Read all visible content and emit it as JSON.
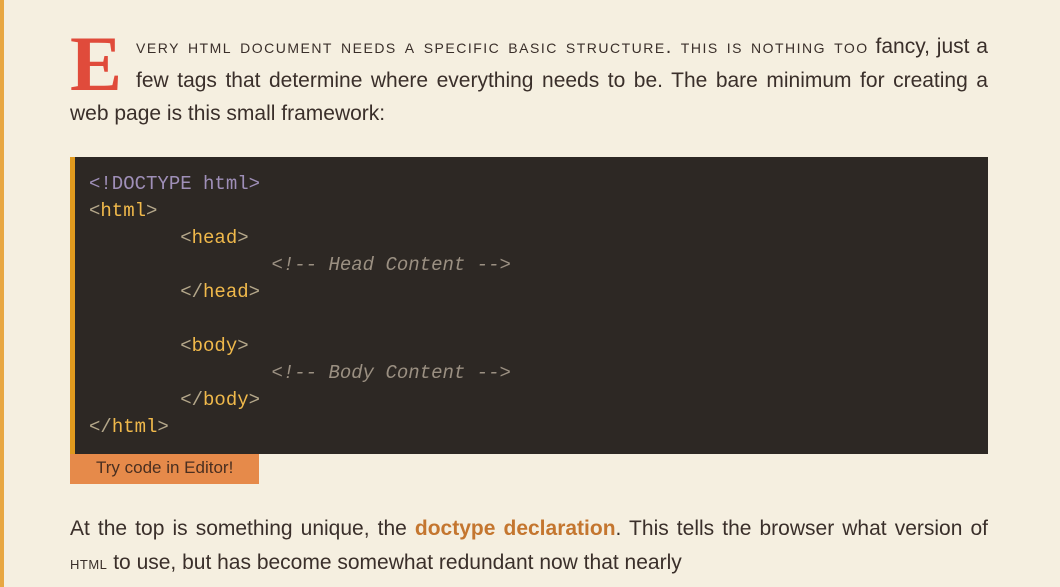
{
  "para1": {
    "dropcap": "E",
    "smallcaps_lead": "very html document needs a specific basic structure. this is nothing too",
    "rest": " fancy, just a few tags that determine where everything needs to be. The bare minimum for creating a web page is this small framework:"
  },
  "code": {
    "l1_doctype": "<!DOCTYPE html>",
    "tag_html_open": "html",
    "tag_head_open": "head",
    "comment_head": "<!-- Head Content -->",
    "tag_head_close": "head",
    "tag_body_open": "body",
    "comment_body": "<!-- Body Content -->",
    "tag_body_close": "body",
    "tag_html_close": "html",
    "punc_lt": "<",
    "punc_gt": ">",
    "punc_lts": "</"
  },
  "button": {
    "label": "Try code in Editor!"
  },
  "para2": {
    "before_link": "At the top is something unique, the ",
    "link_text": "doctype declaration",
    "after_link_1": ". This tells the browser what version of ",
    "smallcaps": "html",
    "after_link_2": " to use, but has become somewhat redundant now that nearly"
  }
}
